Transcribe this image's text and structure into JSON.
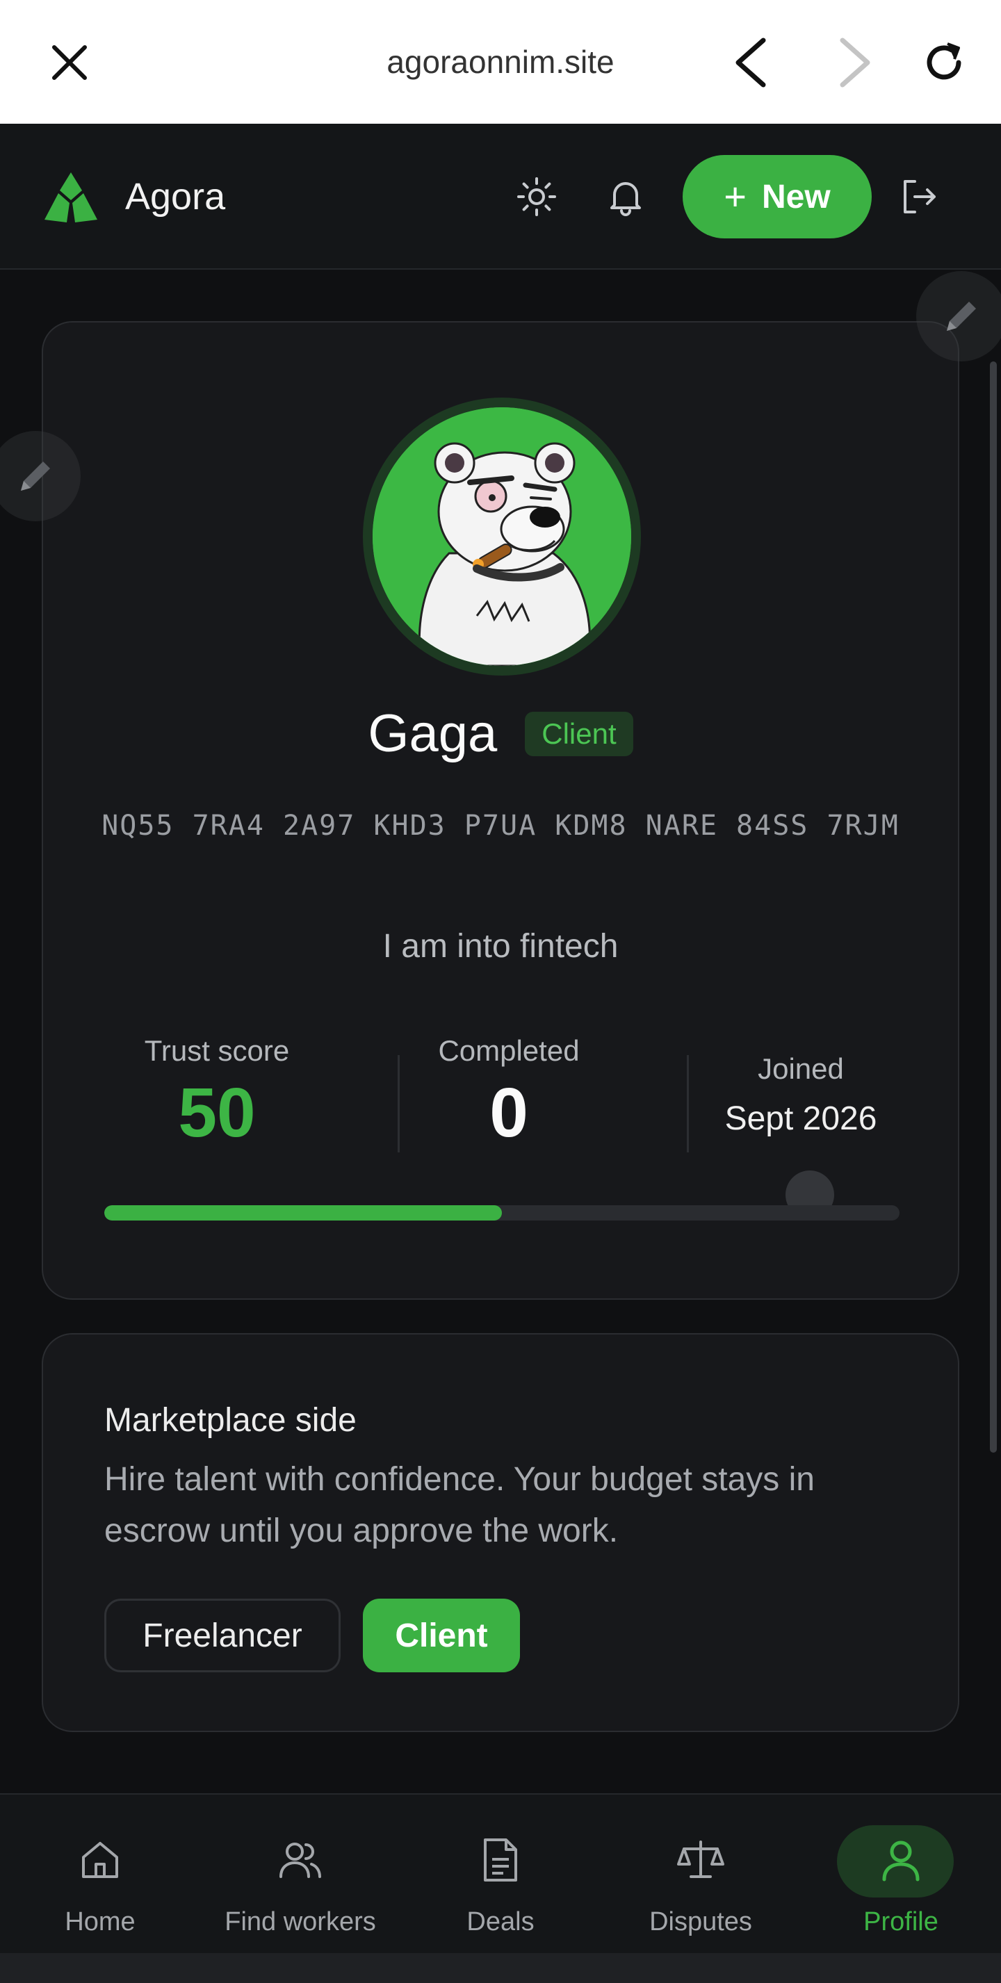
{
  "browser": {
    "url": "agoraonnim.site",
    "close_icon": "close-icon",
    "back_icon": "chevron-left-icon",
    "forward_icon": "chevron-right-icon",
    "reload_icon": "reload-icon"
  },
  "header": {
    "brand": "Agora",
    "new_button_label": "New",
    "icons": [
      "sun-icon",
      "bell-icon",
      "logout-icon"
    ]
  },
  "profile": {
    "name": "Gaga",
    "role": "Client",
    "address": "NQ55 7RA4 2A97 KHD3 P7UA KDM8 NARE 84SS 7RJM",
    "bio": "I am into fintech",
    "stats": {
      "trust_label": "Trust score",
      "trust_value": "50",
      "completed_label": "Completed",
      "completed_value": "0",
      "joined_label": "Joined",
      "joined_value": "Sept 2026"
    },
    "trust_progress": 0.5
  },
  "marketplace": {
    "title": "Marketplace side",
    "description": "Hire talent with confidence. Your budget stays in escrow until you approve the work.",
    "options": [
      "Freelancer",
      "Client"
    ],
    "selected": "Client"
  },
  "bottom_nav": {
    "items": [
      {
        "label": "Home",
        "icon": "home-icon"
      },
      {
        "label": "Find workers",
        "icon": "users-icon"
      },
      {
        "label": "Deals",
        "icon": "document-icon"
      },
      {
        "label": "Disputes",
        "icon": "scale-icon"
      },
      {
        "label": "Profile",
        "icon": "user-icon"
      }
    ],
    "active": "Profile"
  },
  "colors": {
    "accent": "#3bb143",
    "background": "#0f1012",
    "card": "#17181b"
  }
}
